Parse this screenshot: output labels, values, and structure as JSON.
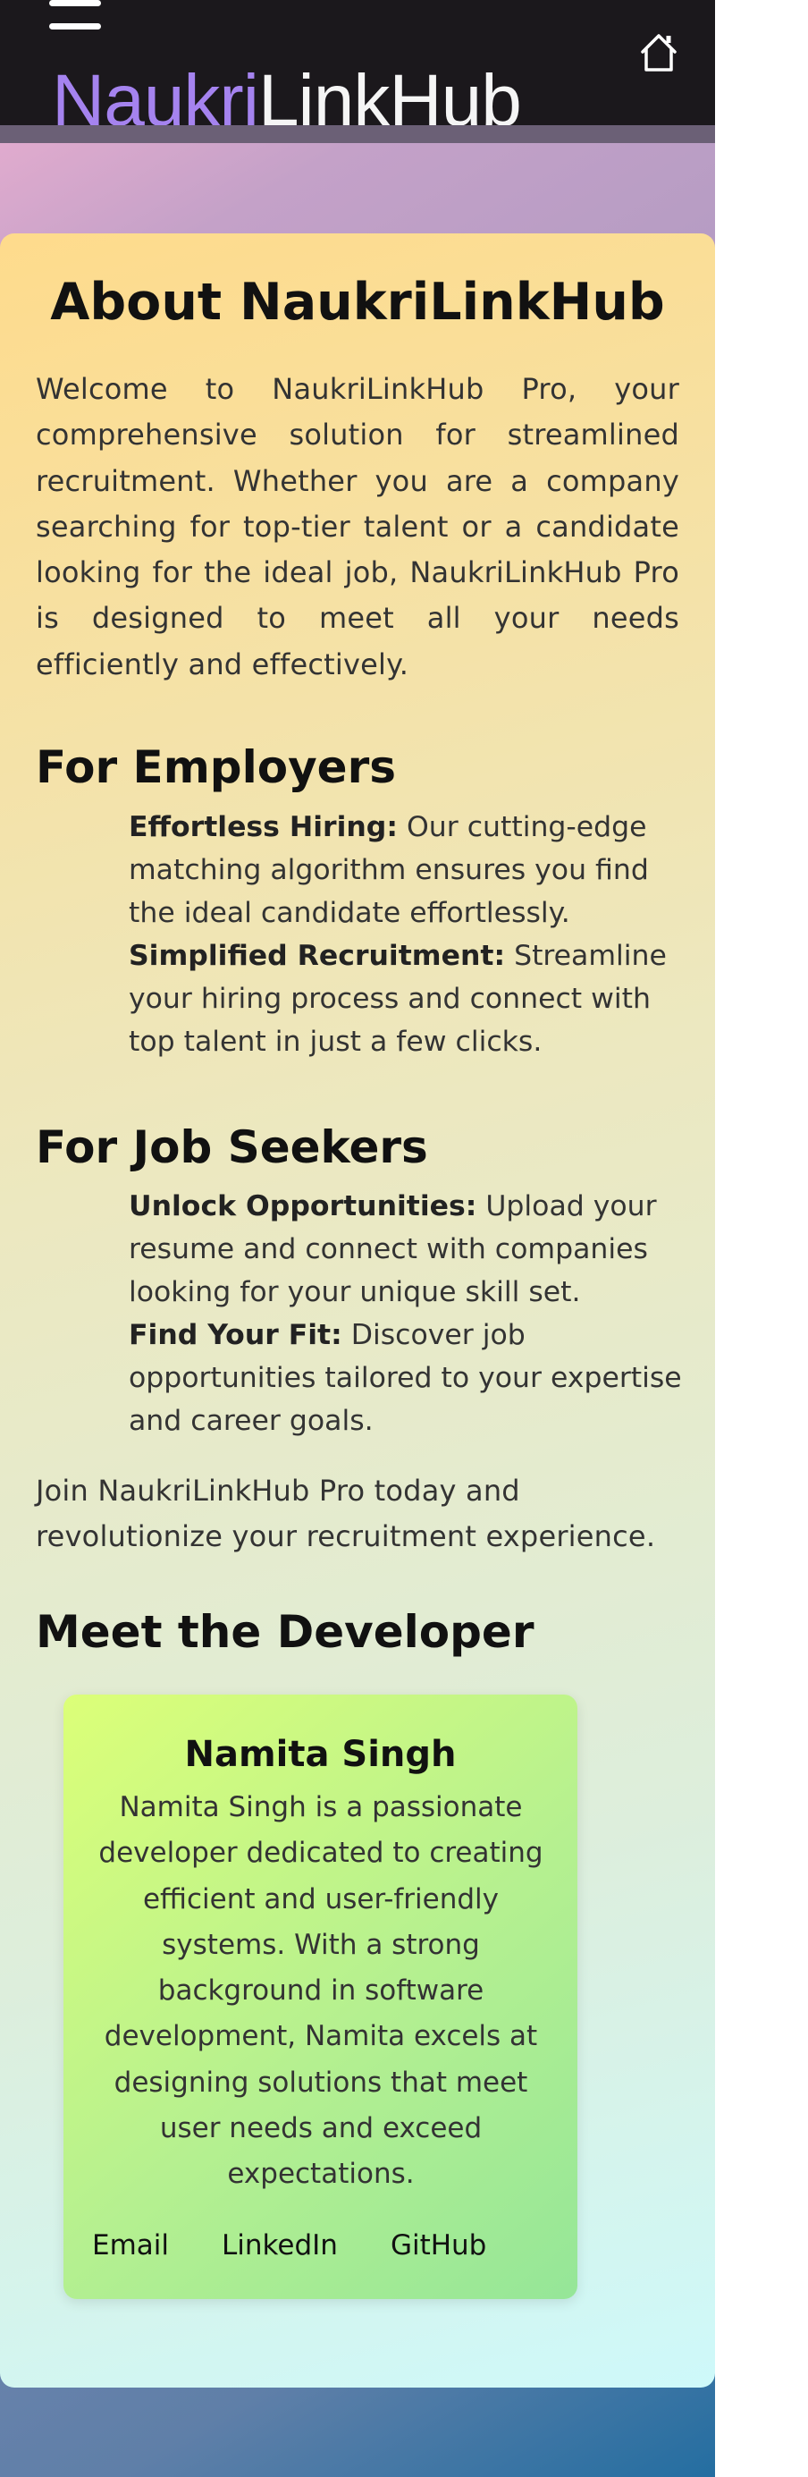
{
  "header": {
    "logo_part1": "Naukri",
    "logo_part2": "LinkHub",
    "icons": [
      "hamburger-menu-icon",
      "home-icon"
    ]
  },
  "about": {
    "title": "About NaukriLinkHub",
    "intro": "Welcome to NaukriLinkHub Pro, your comprehensive solution for streamlined recruitment. Whether you are a company searching for top-tier talent or a candidate looking for the ideal job, NaukriLinkHub Pro is designed to meet all your needs efficiently and effectively.",
    "employers": {
      "heading": "For Employers",
      "items": [
        {
          "title": "Effortless Hiring:",
          "text": " Our cutting-edge matching algorithm ensures you find the ideal candidate effortlessly."
        },
        {
          "title": "Simplified Recruitment:",
          "text": " Streamline your hiring process and connect with top talent in just a few clicks."
        }
      ]
    },
    "job_seekers": {
      "heading": "For Job Seekers",
      "items": [
        {
          "title": "Unlock Opportunities:",
          "text": " Upload your resume and connect with companies looking for your unique skill set."
        },
        {
          "title": "Find Your Fit:",
          "text": " Discover job opportunities tailored to your expertise and career goals."
        }
      ]
    },
    "closing": "Join NaukriLinkHub Pro today and revolutionize your recruitment experience."
  },
  "developer": {
    "heading": "Meet the Developer",
    "name": "Namita Singh",
    "bio": "Namita Singh is a passionate developer dedicated to creating efficient and user-friendly systems. With a strong background in software development, Namita excels at designing solutions that meet user needs and exceed expectations.",
    "links": {
      "email": "Email",
      "linkedin": "LinkedIn",
      "github": "GitHub"
    }
  },
  "colors": {
    "header_bg": "#1b181c",
    "logo_accent": "#a583ef",
    "logo_text": "#f5f5f5",
    "card_gradient_start": "#fedb8c",
    "card_gradient_end": "#cef9fa",
    "dev_card_gradient_start": "#dcff78",
    "dev_card_gradient_end": "#95e698"
  }
}
